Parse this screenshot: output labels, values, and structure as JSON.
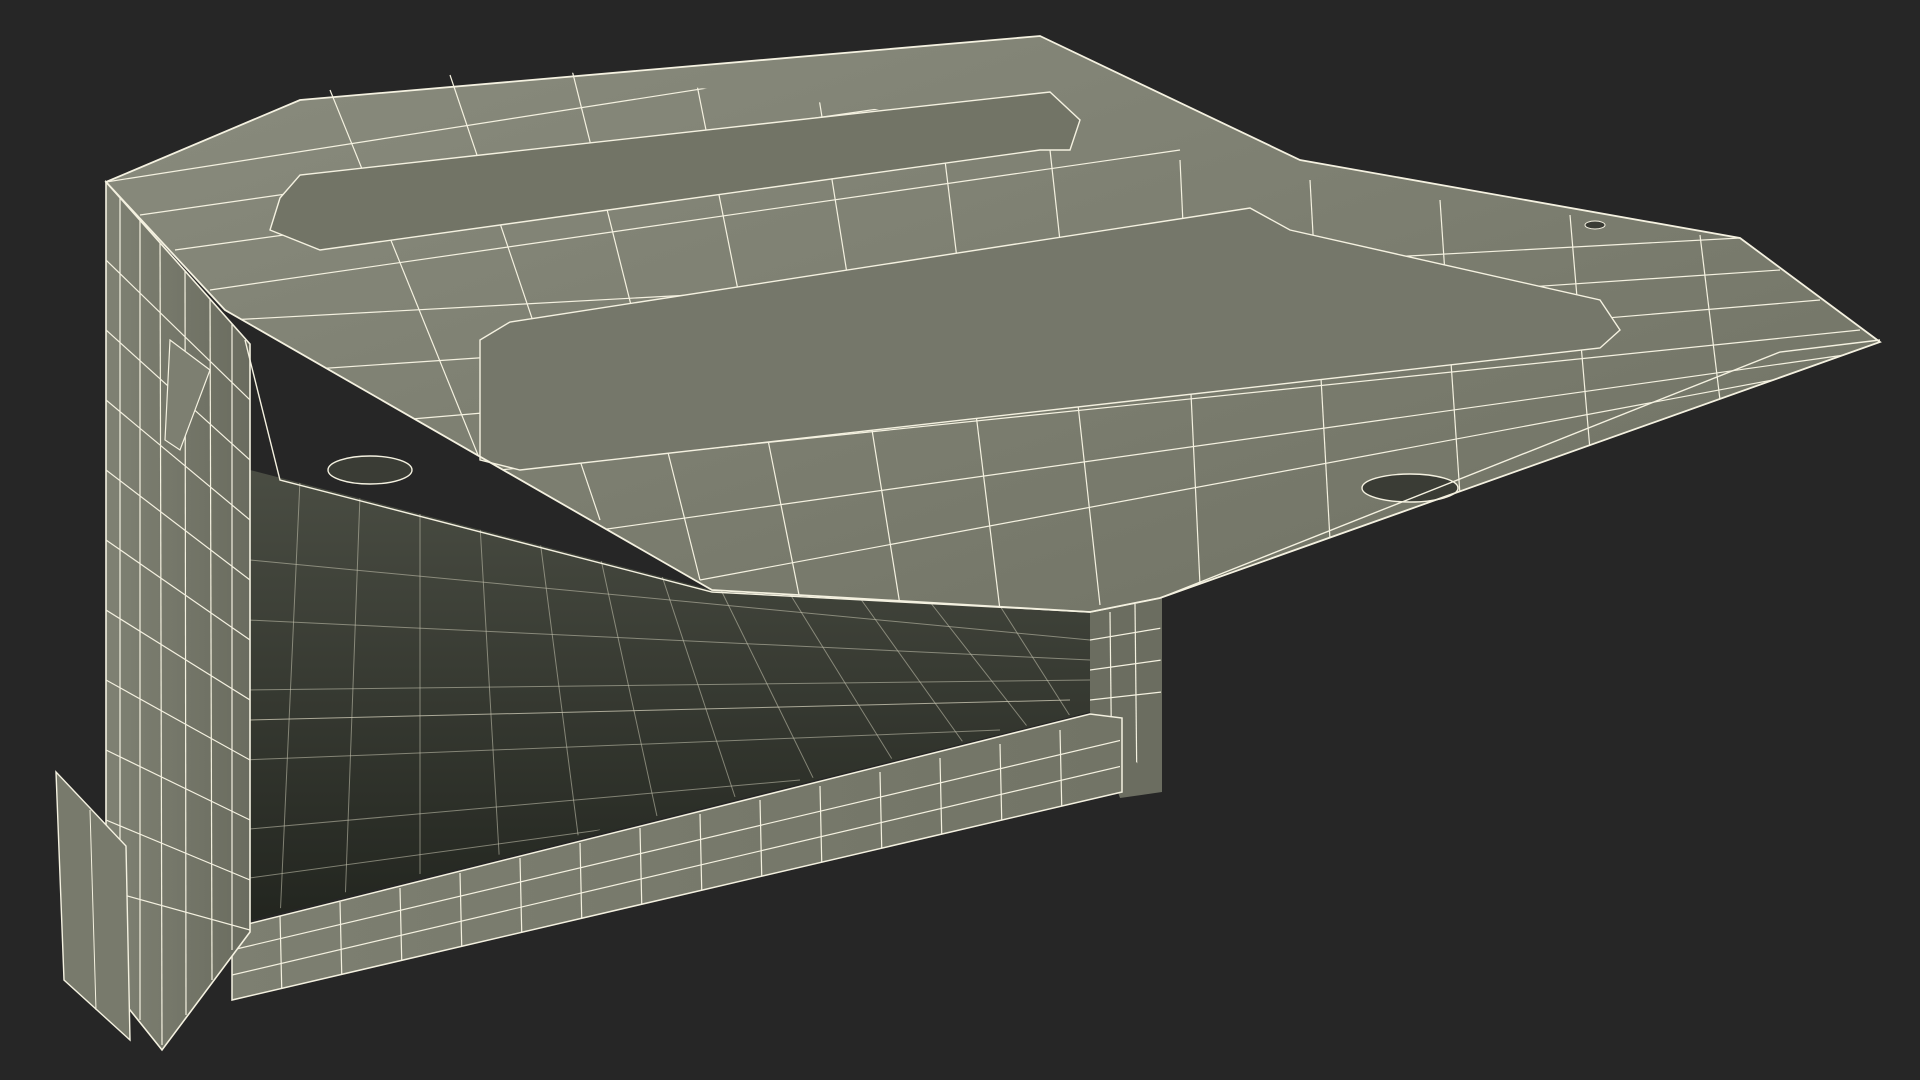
{
  "scene": {
    "subject": "open-box-wireframe",
    "colors": {
      "background": "#262626",
      "surface_light": "#8a8c7e",
      "surface_mid": "#767869",
      "surface_dark": "#3d4037",
      "interior_floor": "#2c2f29",
      "wire": "#f4f1e0",
      "edge_shadow": "#55574c"
    }
  }
}
